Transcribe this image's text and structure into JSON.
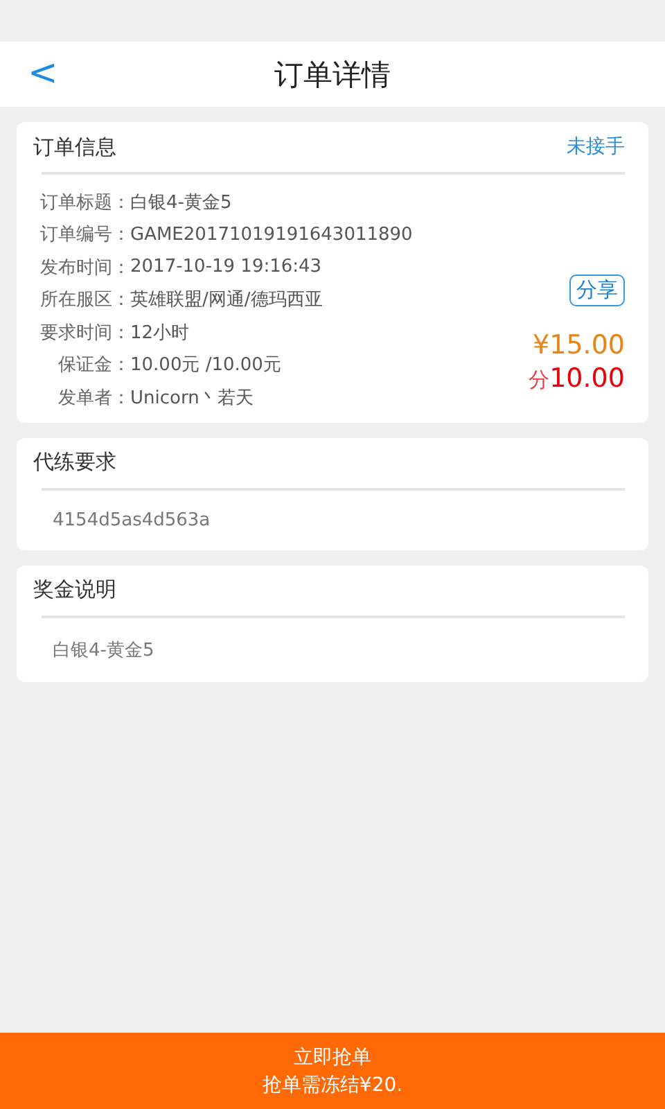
{
  "header": {
    "back": "<",
    "title": "订单详情"
  },
  "order_info": {
    "title": "订单信息",
    "status": "未接手",
    "rows": [
      {
        "label": "订单标题：",
        "value": "白银4-黄金5"
      },
      {
        "label": "订单编号：",
        "value": "GAME20171019191643011890"
      },
      {
        "label": "发布时间：",
        "value": "2017-10-19 19:16:43"
      },
      {
        "label": "所在服区：",
        "value": "英雄联盟/网通/德玛西亚"
      },
      {
        "label": "要求时间：",
        "value": "12小时"
      },
      {
        "label": "保证金：",
        "value": "10.00元 /10.00元"
      },
      {
        "label": "发单者：",
        "value": "Unicorn丶若天"
      }
    ],
    "share": "分享",
    "price": "¥15.00",
    "points_symbol": "分",
    "points": "10.00"
  },
  "sections": [
    {
      "title": "代练要求",
      "body": "4154d5as4d563a"
    },
    {
      "title": "奖金说明",
      "body": "白银4-黄金5"
    }
  ],
  "bottom_bar": {
    "action": "立即抢单",
    "note": "抢单需冻结¥20."
  }
}
